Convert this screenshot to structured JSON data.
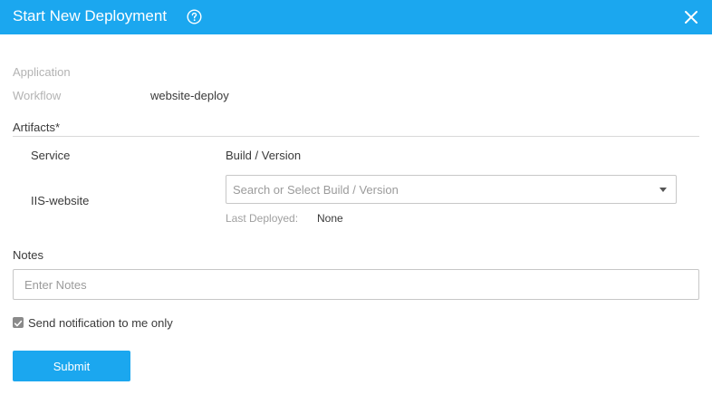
{
  "header": {
    "title": "Start New Deployment",
    "help_icon": "question-circle-icon",
    "close_icon": "close-icon",
    "background_color": "#1ba7ef"
  },
  "details": {
    "application_label": "Application",
    "application_value": "",
    "workflow_label": "Workflow",
    "workflow_value": "website-deploy"
  },
  "artifacts": {
    "title": "Artifacts*",
    "columns": {
      "service": "Service",
      "build_version": "Build / Version"
    },
    "rows": [
      {
        "service": "IIS-website",
        "build_placeholder": "Search or Select Build / Version",
        "last_deployed_label": "Last Deployed:",
        "last_deployed_value": "None"
      }
    ]
  },
  "notes": {
    "label": "Notes",
    "placeholder": "Enter Notes",
    "value": ""
  },
  "notification": {
    "label": "Send notification to me only",
    "checked": true
  },
  "actions": {
    "submit_label": "Submit"
  }
}
